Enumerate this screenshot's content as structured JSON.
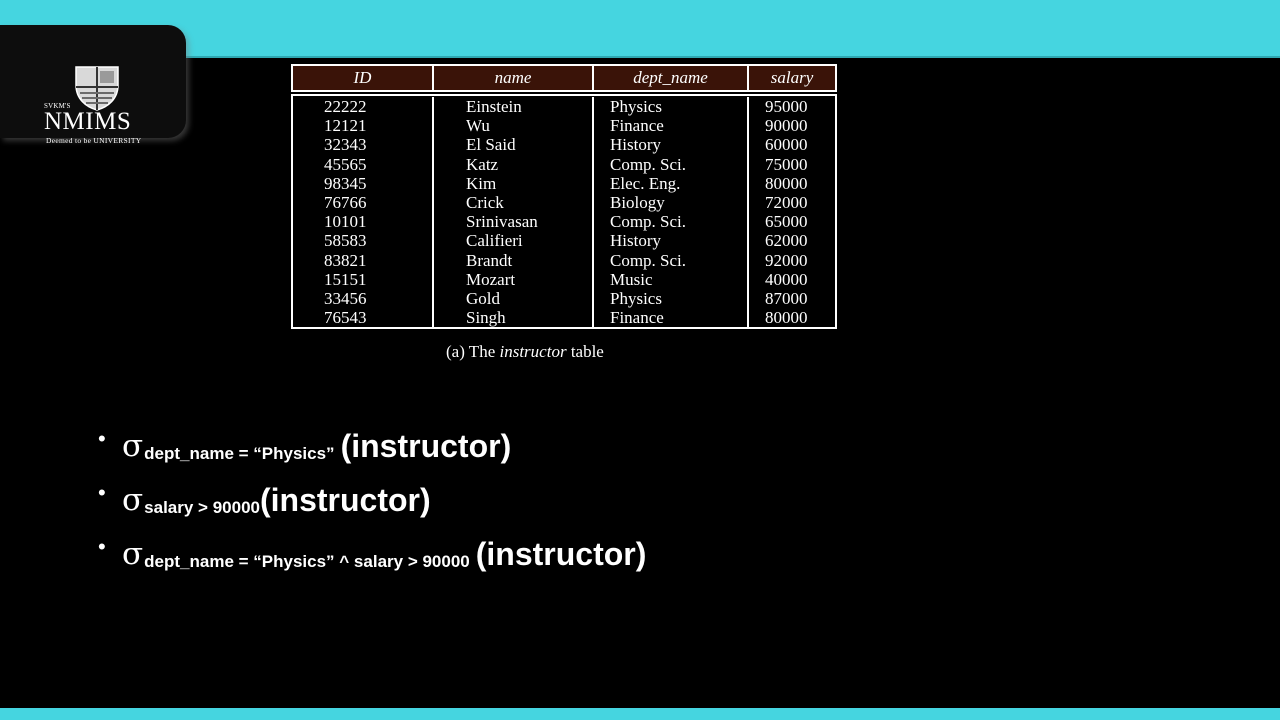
{
  "logo": {
    "small_text": "SVKM'S",
    "name": "NMIMS",
    "tagline": "Deemed to be UNIVERSITY"
  },
  "table": {
    "headers": [
      "ID",
      "name",
      "dept_name",
      "salary"
    ],
    "rows": [
      [
        "22222",
        "Einstein",
        "Physics",
        "95000"
      ],
      [
        "12121",
        "Wu",
        "Finance",
        "90000"
      ],
      [
        "32343",
        "El Said",
        "History",
        "60000"
      ],
      [
        "45565",
        "Katz",
        "Comp. Sci.",
        "75000"
      ],
      [
        "98345",
        "Kim",
        "Elec. Eng.",
        "80000"
      ],
      [
        "76766",
        "Crick",
        "Biology",
        "72000"
      ],
      [
        "10101",
        "Srinivasan",
        "Comp. Sci.",
        "65000"
      ],
      [
        "58583",
        "Califieri",
        "History",
        "62000"
      ],
      [
        "83821",
        "Brandt",
        "Comp. Sci.",
        "92000"
      ],
      [
        "15151",
        "Mozart",
        "Music",
        "40000"
      ],
      [
        "33456",
        "Gold",
        "Physics",
        "87000"
      ],
      [
        "76543",
        "Singh",
        "Finance",
        "80000"
      ]
    ],
    "caption_prefix": "(a) The",
    "caption_italic": "instructor",
    "caption_suffix": "table"
  },
  "bullets": [
    {
      "symbol": "σ",
      "subscript": "dept_name  = “Physics”",
      "relation": "(instructor)"
    },
    {
      "symbol": "σ",
      "subscript": "salary  > 90000",
      "relation": "(instructor)"
    },
    {
      "symbol": "σ",
      "subscript": "dept_name  = “Physics” ^ salary > 90000",
      "relation": "(instructor)"
    }
  ],
  "colors": {
    "band": "#45d5e0",
    "background": "#000000",
    "table_header": "#3a1308"
  }
}
